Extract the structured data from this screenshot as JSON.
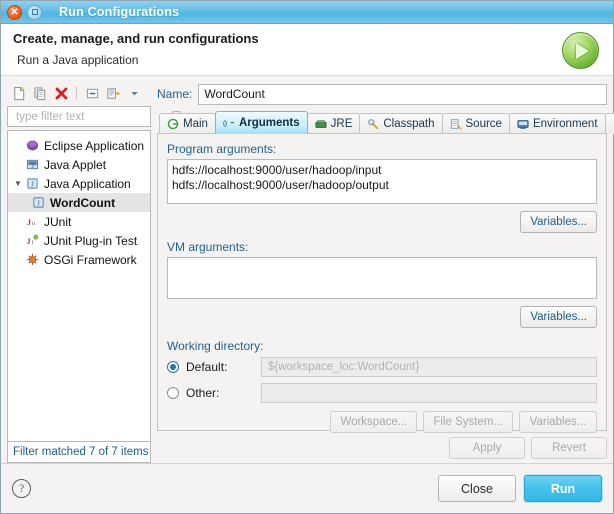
{
  "window": {
    "title": "Run Configurations",
    "close_icon": "close-icon",
    "maximize_icon": "maximize-icon"
  },
  "header": {
    "title": "Create, manage, and run configurations",
    "subtitle": "Run a Java application",
    "badge_icon": "run-play-icon"
  },
  "tree_toolbar": {
    "items": [
      {
        "name": "new-launch-configuration",
        "icon": "new-document-icon"
      },
      {
        "name": "duplicate-launch-configuration",
        "icon": "copy-icon"
      },
      {
        "name": "delete-launch-configuration",
        "icon": "delete-x-icon"
      },
      {
        "name": "collapse-all",
        "icon": "collapse-all-icon"
      },
      {
        "name": "filter-launch-configurations",
        "icon": "filter-icon"
      },
      {
        "name": "view-menu",
        "icon": "chevron-down-icon"
      }
    ]
  },
  "filter": {
    "placeholder": "type filter text",
    "value": "",
    "clear_icon": "clear-icon"
  },
  "tree": {
    "items": [
      {
        "label": "Eclipse Application",
        "icon": "eclipse-icon",
        "indent": false,
        "expandable": false,
        "selected": false
      },
      {
        "label": "Java Applet",
        "icon": "java-applet-icon",
        "indent": false,
        "expandable": false,
        "selected": false
      },
      {
        "label": "Java Application",
        "icon": "java-application-icon",
        "indent": false,
        "expandable": true,
        "expanded": true,
        "selected": false
      },
      {
        "label": "WordCount",
        "icon": "java-application-icon",
        "indent": true,
        "expandable": false,
        "selected": true
      },
      {
        "label": "JUnit",
        "icon": "junit-icon",
        "indent": false,
        "expandable": false,
        "selected": false
      },
      {
        "label": "JUnit Plug-in Test",
        "icon": "junit-plugin-icon",
        "indent": false,
        "expandable": false,
        "selected": false
      },
      {
        "label": "OSGi Framework",
        "icon": "osgi-icon",
        "indent": false,
        "expandable": false,
        "selected": false
      }
    ]
  },
  "filter_status": "Filter matched 7 of 7 items",
  "name_field": {
    "label": "Name:",
    "value": "WordCount"
  },
  "tabs": [
    {
      "label": "Main",
      "icon": "main-tab-icon",
      "active": false
    },
    {
      "label": "Arguments",
      "icon": "arguments-tab-icon",
      "active": true
    },
    {
      "label": "JRE",
      "icon": "jre-tab-icon",
      "active": false
    },
    {
      "label": "Classpath",
      "icon": "classpath-tab-icon",
      "active": false
    },
    {
      "label": "Source",
      "icon": "source-tab-icon",
      "active": false
    },
    {
      "label": "Environment",
      "icon": "environment-tab-icon",
      "active": false
    },
    {
      "label": "",
      "icon": "common-tab-icon",
      "active": false
    }
  ],
  "arguments_tab": {
    "program_arguments": {
      "label": "Program arguments:",
      "value": "hdfs://localhost:9000/user/hadoop/input  hdfs://localhost:9000/user/hadoop/output",
      "variables_button": "Variables..."
    },
    "vm_arguments": {
      "label": "VM arguments:",
      "value": "",
      "variables_button": "Variables..."
    },
    "working_directory": {
      "label": "Working directory:",
      "default_label": "Default:",
      "default_selected": true,
      "default_value": "${workspace_loc:WordCount}",
      "other_label": "Other:",
      "other_selected": false,
      "other_value": "",
      "workspace_button": "Workspace...",
      "filesystem_button": "File System...",
      "variables_button": "Variables..."
    }
  },
  "action_buttons": {
    "apply": "Apply",
    "apply_enabled": false,
    "revert": "Revert",
    "revert_enabled": false
  },
  "footer": {
    "help_icon": "help-icon",
    "close": "Close",
    "run": "Run"
  },
  "colors": {
    "titlebar": "#4eb4e2",
    "accent_blue": "#24618c",
    "run_button": "#45c1ec",
    "close_button": "#e8540e",
    "run_badge_green": "#6fb534",
    "selection": "#e4e4e4"
  }
}
